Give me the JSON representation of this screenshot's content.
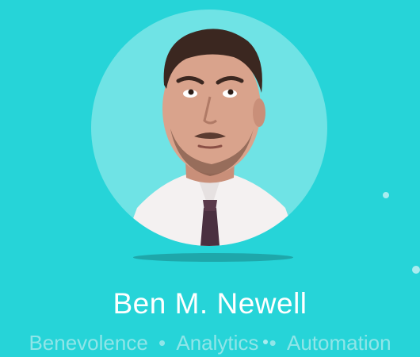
{
  "profile": {
    "name": "Ben M. Newell",
    "tagline": {
      "word1": "Benevolence",
      "sep1": "•",
      "word2": "Analytics",
      "sep2": "•",
      "word3": "Automation"
    }
  },
  "colors": {
    "background": "#26d4d8",
    "avatar_circle": "#6fe3e5",
    "name_text": "#ffffff",
    "tagline_text": "#8fe5e8",
    "dot": "#a9ecef"
  }
}
